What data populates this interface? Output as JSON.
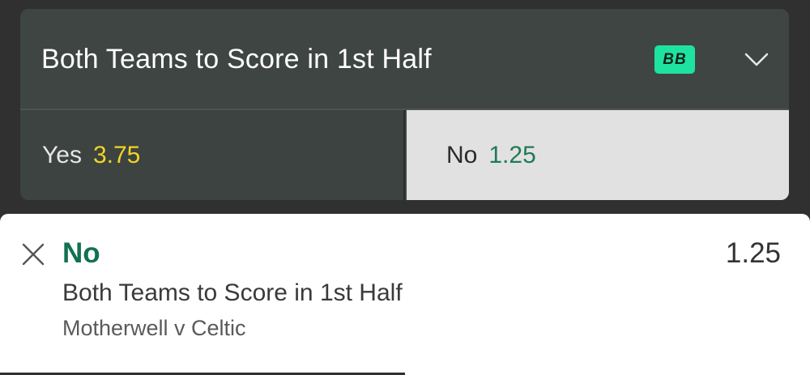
{
  "market": {
    "title": "Both Teams to Score in 1st Half",
    "badge": "BB",
    "expand_icon": "chevron-down-icon",
    "outcomes": [
      {
        "label": "Yes",
        "odds": "3.75",
        "selected": false
      },
      {
        "label": "No",
        "odds": "1.25",
        "selected": true
      }
    ]
  },
  "betslip": {
    "close_icon": "close-icon",
    "selection": "No",
    "odds": "1.25",
    "market": "Both Teams to Score in 1st Half",
    "event": "Motherwell v Celtic"
  },
  "colors": {
    "background": "#2f302f",
    "card": "#3f4542",
    "badge": "#1ee3a0",
    "yes_odds": "#f4d323",
    "no_odds": "#1f7a57",
    "selected_outcome_bg": "#e1e1e1",
    "selection_green": "#137150"
  }
}
